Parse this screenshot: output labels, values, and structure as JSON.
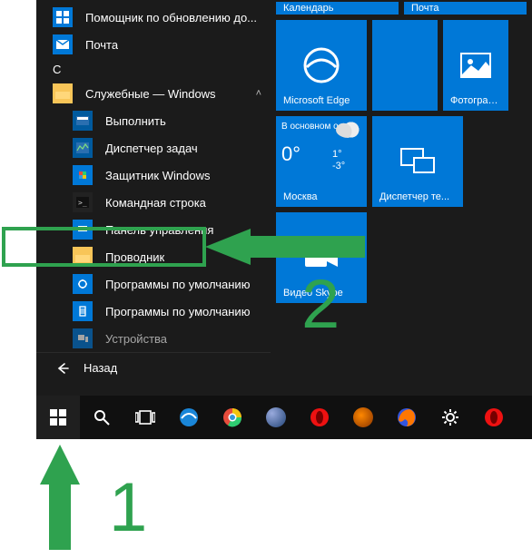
{
  "apps": {
    "topItems": [
      {
        "label": "Помощник по обновлению до...",
        "icon": "windows-icon",
        "iconBg": "ic-blue"
      },
      {
        "label": "Почта",
        "icon": "mail-icon",
        "iconBg": "ic-blue"
      }
    ],
    "letter": "С",
    "folder": {
      "label": "Служебные — Windows",
      "icon": "folder-icon",
      "iconBg": "ic-folder"
    },
    "subItems": [
      {
        "label": "Выполнить",
        "icon": "run-icon",
        "iconBg": "ic-dblue"
      },
      {
        "label": "Диспетчер задач",
        "icon": "taskmgr-icon",
        "iconBg": "ic-dblue"
      },
      {
        "label": "Защитник Windows",
        "icon": "defender-icon",
        "iconBg": "ic-blue"
      },
      {
        "label": "Командная строка",
        "icon": "cmd-icon",
        "iconBg": "ic-dark"
      },
      {
        "label": "Панель управления",
        "icon": "controlpanel-icon",
        "iconBg": "ic-blue"
      },
      {
        "label": "Проводник",
        "icon": "explorer-icon",
        "iconBg": "ic-folder"
      },
      {
        "label": "Программы по умолчанию",
        "icon": "defaults-icon",
        "iconBg": "ic-blue"
      },
      {
        "label": "Программы по умолчанию",
        "icon": "defaults-icon",
        "iconBg": "ic-blue"
      },
      {
        "label": "Устройства",
        "icon": "devices-icon",
        "iconBg": "ic-blue"
      }
    ],
    "back": "Назад"
  },
  "tiles": {
    "topSmall": [
      {
        "label": "Календарь"
      },
      {
        "label": "Почта"
      }
    ],
    "edge": "Microsoft Edge",
    "photos": "Фотографии",
    "weather": {
      "top": "В основном о...",
      "temp": "0°",
      "hi": "1°",
      "lo": "-3°",
      "city": "Москва"
    },
    "remote": "Диспетчер те...",
    "skype": "Видео Skype"
  },
  "annotations": {
    "step1": "1",
    "step2": "2",
    "color": "#2fa24f"
  },
  "taskbar": [
    {
      "name": "start-button",
      "icon": "windows-logo-icon"
    },
    {
      "name": "search-button",
      "icon": "search-icon"
    },
    {
      "name": "taskview-button",
      "icon": "taskview-icon"
    },
    {
      "name": "edge-taskbar",
      "icon": "edge-icon"
    },
    {
      "name": "chrome-taskbar",
      "icon": "chrome-icon"
    },
    {
      "name": "app-taskbar-1",
      "icon": "globe-icon"
    },
    {
      "name": "opera-taskbar",
      "icon": "opera-icon"
    },
    {
      "name": "app-taskbar-2",
      "icon": "brush-icon"
    },
    {
      "name": "firefox-taskbar",
      "icon": "firefox-icon"
    },
    {
      "name": "settings-taskbar",
      "icon": "gear-icon"
    },
    {
      "name": "opera-taskbar-2",
      "icon": "opera-icon"
    }
  ]
}
